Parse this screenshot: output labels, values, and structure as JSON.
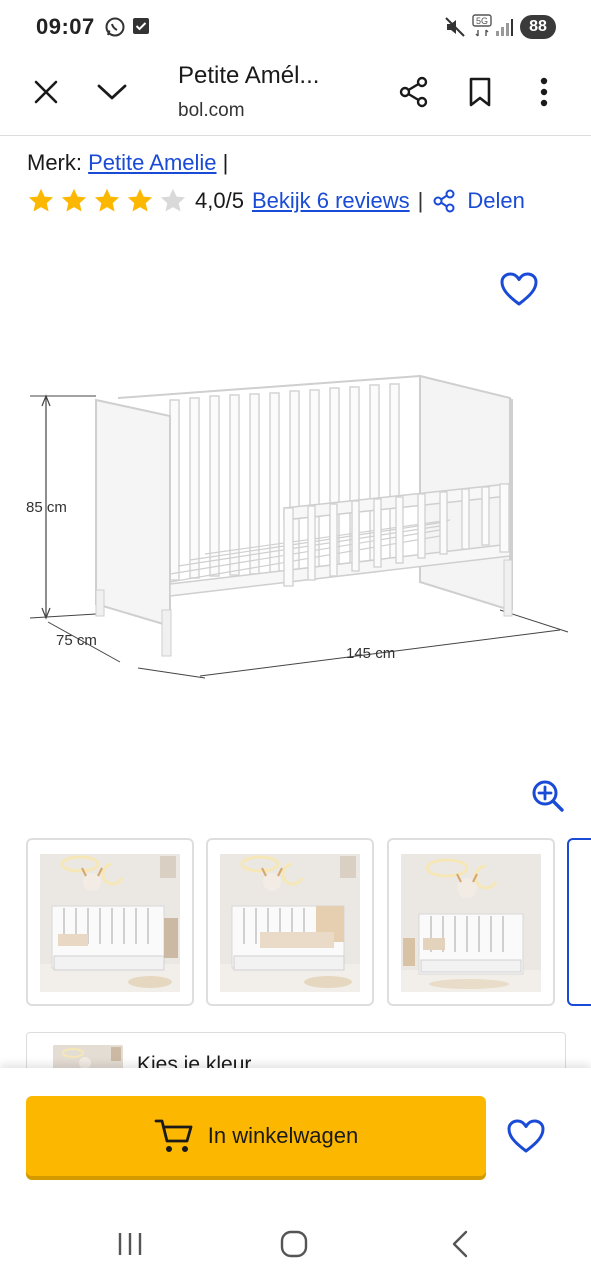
{
  "status_bar": {
    "time": "09:07",
    "battery": "88",
    "network": "5G"
  },
  "browser": {
    "page_title": "Petite Amél...",
    "url": "bol.com"
  },
  "product": {
    "brand_label": "Merk:",
    "brand_name": "Petite Amelie",
    "brand_separator": "|",
    "rating": {
      "stars_filled": 4,
      "stars_total": 5,
      "value": "4,0/5",
      "reviews_link": "Bekijk 6 reviews",
      "separator": "|",
      "share_label": "Delen"
    },
    "dimensions": {
      "height": "85 cm",
      "depth": "75 cm",
      "width": "145 cm"
    },
    "color_chooser_label": "Kies je kleur"
  },
  "thumbnails": [
    {
      "alt": "crib-with-drawer"
    },
    {
      "alt": "crib-with-toddler-rail"
    },
    {
      "alt": "crib-room-view"
    }
  ],
  "bottom_bar": {
    "cart_button": "In winkelwagen"
  },
  "colors": {
    "accent_blue": "#1a4bd6",
    "star_yellow": "#fcb800",
    "cart_button": "#fcb800",
    "star_empty": "#d9d9d9"
  }
}
